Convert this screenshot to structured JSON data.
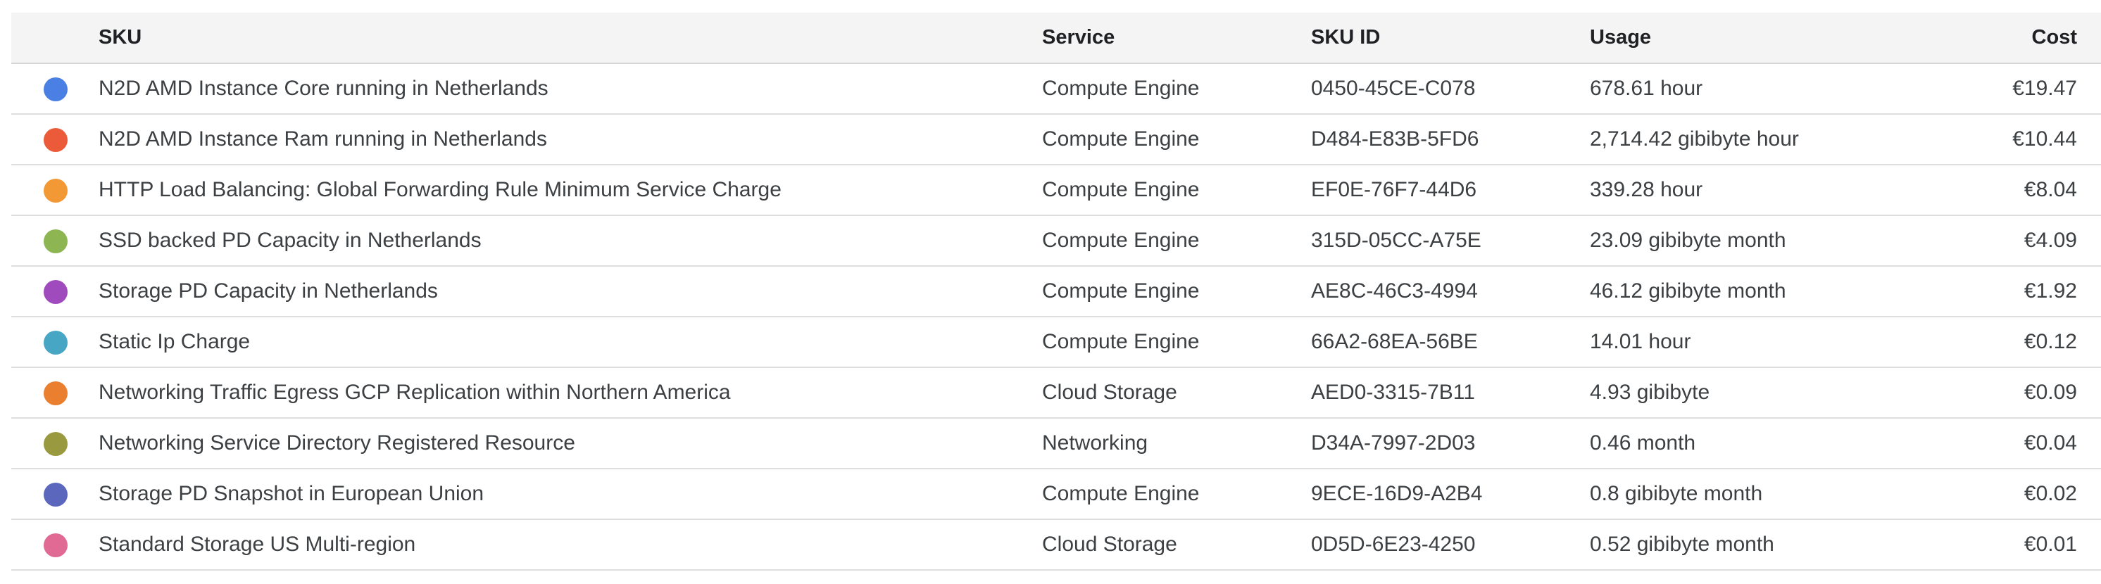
{
  "table": {
    "headers": {
      "sku": "SKU",
      "service": "Service",
      "sku_id": "SKU ID",
      "usage": "Usage",
      "cost": "Cost"
    },
    "rows": [
      {
        "color": "#4a7fe4",
        "sku": "N2D AMD Instance Core running in Netherlands",
        "service": "Compute Engine",
        "sku_id": "0450-45CE-C078",
        "usage": "678.61 hour",
        "cost": "€19.47"
      },
      {
        "color": "#ec5b39",
        "sku": "N2D AMD Instance Ram running in Netherlands",
        "service": "Compute Engine",
        "sku_id": "D484-E83B-5FD6",
        "usage": "2,714.42 gibibyte hour",
        "cost": "€10.44"
      },
      {
        "color": "#f29935",
        "sku": "HTTP Load Balancing: Global Forwarding Rule Minimum Service Charge",
        "service": "Compute Engine",
        "sku_id": "EF0E-76F7-44D6",
        "usage": "339.28 hour",
        "cost": "€8.04"
      },
      {
        "color": "#8db653",
        "sku": "SSD backed PD Capacity in Netherlands",
        "service": "Compute Engine",
        "sku_id": "315D-05CC-A75E",
        "usage": "23.09 gibibyte month",
        "cost": "€4.09"
      },
      {
        "color": "#a04bbd",
        "sku": "Storage PD Capacity in Netherlands",
        "service": "Compute Engine",
        "sku_id": "AE8C-46C3-4994",
        "usage": "46.12 gibibyte month",
        "cost": "€1.92"
      },
      {
        "color": "#46a6c3",
        "sku": "Static Ip Charge",
        "service": "Compute Engine",
        "sku_id": "66A2-68EA-56BE",
        "usage": "14.01 hour",
        "cost": "€0.12"
      },
      {
        "color": "#ea7f30",
        "sku": "Networking Traffic Egress GCP Replication within Northern America",
        "service": "Cloud Storage",
        "sku_id": "AED0-3315-7B11",
        "usage": "4.93 gibibyte",
        "cost": "€0.09"
      },
      {
        "color": "#999a3f",
        "sku": "Networking Service Directory Registered Resource",
        "service": "Networking",
        "sku_id": "D34A-7997-2D03",
        "usage": "0.46 month",
        "cost": "€0.04"
      },
      {
        "color": "#5b67bd",
        "sku": "Storage PD Snapshot in European Union",
        "service": "Compute Engine",
        "sku_id": "9ECE-16D9-A2B4",
        "usage": "0.8 gibibyte month",
        "cost": "€0.02"
      },
      {
        "color": "#e06a94",
        "sku": "Standard Storage US Multi-region",
        "service": "Cloud Storage",
        "sku_id": "0D5D-6E23-4250",
        "usage": "0.52 gibibyte month",
        "cost": "€0.01"
      }
    ]
  }
}
